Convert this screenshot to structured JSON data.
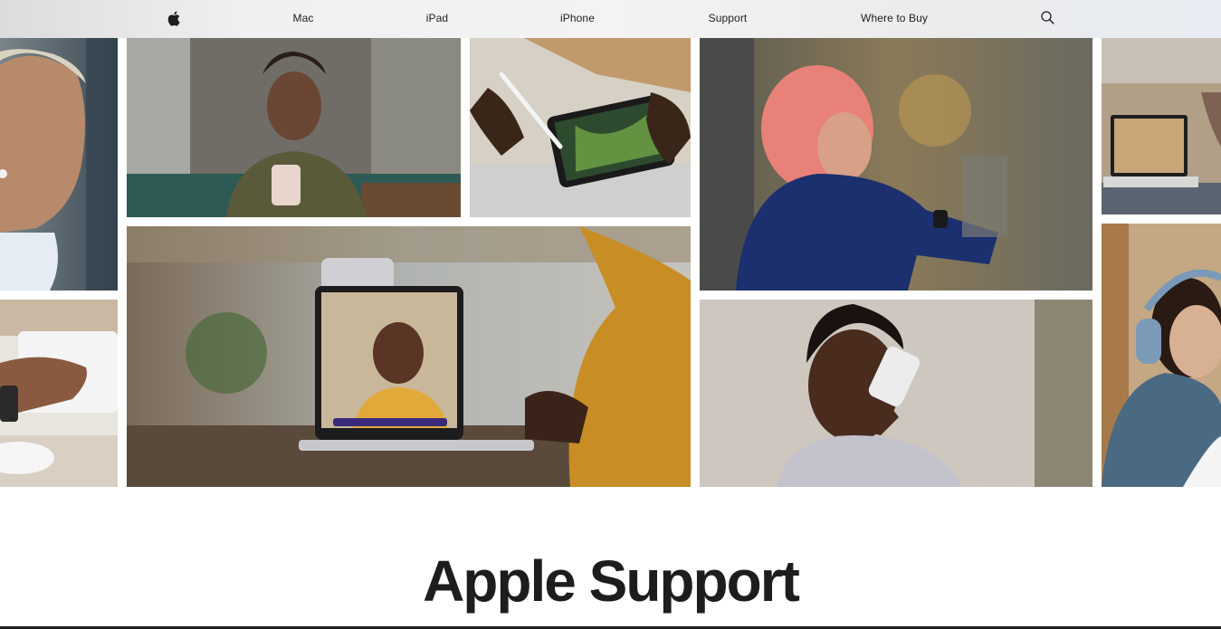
{
  "nav": {
    "logo_icon": "apple-logo-icon",
    "items": [
      {
        "label": "Mac"
      },
      {
        "label": "iPad"
      },
      {
        "label": "iPhone"
      },
      {
        "label": "Support"
      },
      {
        "label": "Where to Buy"
      }
    ],
    "search_icon": "search-icon"
  },
  "hero": {
    "tiles": [
      {
        "subject": "man-wearing-airpods"
      },
      {
        "subject": "woman-with-iphone-and-airpods"
      },
      {
        "subject": "ipad-with-apple-pencil"
      },
      {
        "subject": "woman-checking-apple-watch"
      },
      {
        "subject": "macbook-on-desk"
      },
      {
        "subject": "hand-with-apple-watch"
      },
      {
        "subject": "facetime-call-on-macbook"
      },
      {
        "subject": "man-on-iphone-call"
      },
      {
        "subject": "woman-wearing-airpods-max"
      }
    ]
  },
  "page": {
    "title": "Apple Support"
  },
  "colors": {
    "text": "#1d1d1f",
    "nav_bg": "#f3f3f3",
    "page_bg": "#ffffff"
  }
}
